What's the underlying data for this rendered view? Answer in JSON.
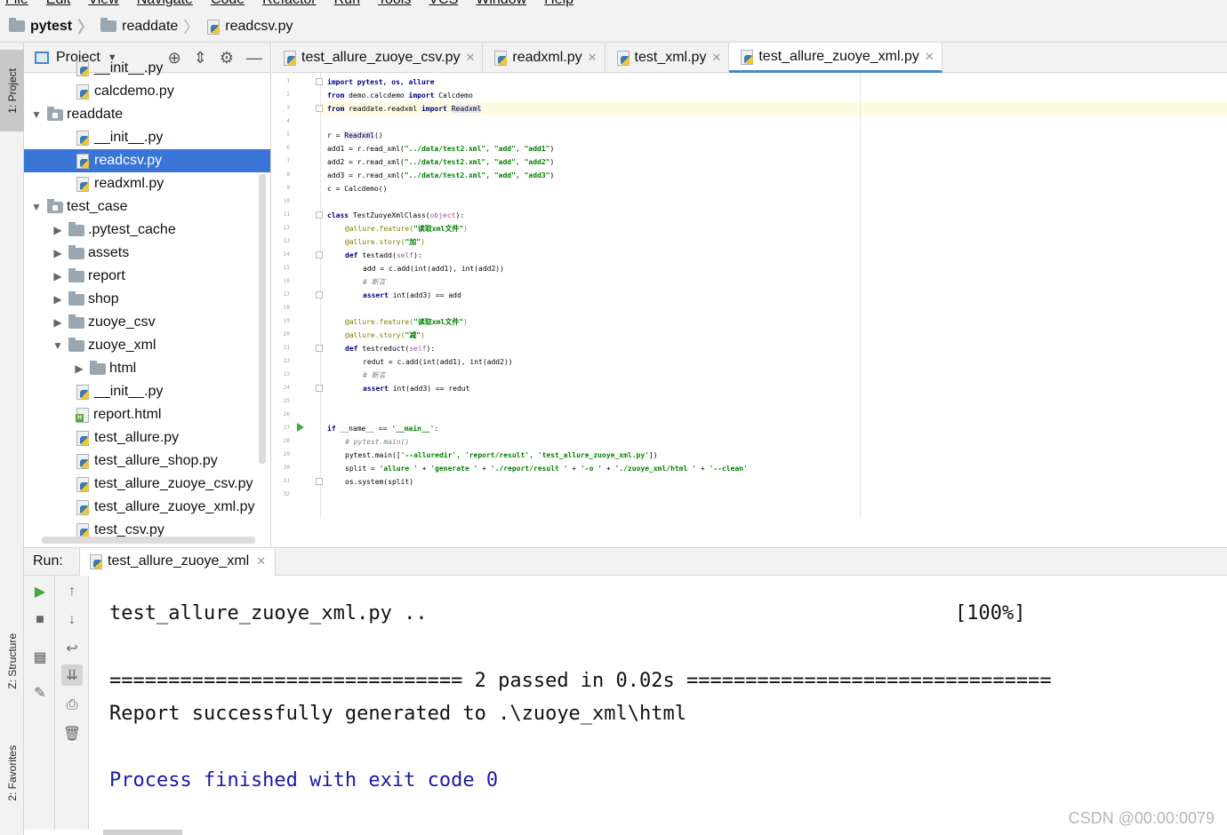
{
  "menubar": [
    "File",
    "Edit",
    "View",
    "Navigate",
    "Code",
    "Refactor",
    "Run",
    "Tools",
    "VCS",
    "Window",
    "Help"
  ],
  "breadcrumb": {
    "project": "pytest",
    "folder": "readdate",
    "file": "readcsv.py"
  },
  "left_strip": {
    "project_tab": "1: Project",
    "structure_tab": "Z: Structure",
    "favorites_tab": "2: Favorites"
  },
  "project_panel": {
    "title": "Project",
    "tree": [
      {
        "label": "__init__.py",
        "type": "py"
      },
      {
        "label": "calcdemo.py",
        "type": "py"
      },
      {
        "label": "readdate",
        "type": "dir",
        "expanded": true
      },
      {
        "label": "__init__.py",
        "type": "py"
      },
      {
        "label": "readcsv.py",
        "type": "py",
        "selected": true
      },
      {
        "label": "readxml.py",
        "type": "py"
      },
      {
        "label": "test_case",
        "type": "dir",
        "expanded": true
      },
      {
        "label": ".pytest_cache",
        "type": "dir"
      },
      {
        "label": "assets",
        "type": "dir"
      },
      {
        "label": "report",
        "type": "dir"
      },
      {
        "label": "shop",
        "type": "dir"
      },
      {
        "label": "zuoye_csv",
        "type": "dir"
      },
      {
        "label": "zuoye_xml",
        "type": "dir",
        "expanded": true
      },
      {
        "label": "html",
        "type": "dir"
      },
      {
        "label": "__init__.py",
        "type": "py"
      },
      {
        "label": "report.html",
        "type": "html"
      },
      {
        "label": "test_allure.py",
        "type": "py"
      },
      {
        "label": "test_allure_shop.py",
        "type": "py"
      },
      {
        "label": "test_allure_zuoye_csv.py",
        "type": "py"
      },
      {
        "label": "test_allure_zuoye_xml.py",
        "type": "py"
      },
      {
        "label": "test_csv.py",
        "type": "py"
      }
    ]
  },
  "editor_tabs": [
    {
      "label": "test_allure_zuoye_csv.py",
      "active": false
    },
    {
      "label": "readxml.py",
      "active": false
    },
    {
      "label": "test_xml.py",
      "active": false
    },
    {
      "label": "test_allure_zuoye_xml.py",
      "active": true
    }
  ],
  "code": {
    "line_numbers": [
      "1",
      "2",
      "3",
      "4",
      "5",
      "6",
      "7",
      "8",
      "9",
      "10",
      "11",
      "12",
      "13",
      "14",
      "15",
      "16",
      "17",
      "18",
      "19",
      "20",
      "21",
      "22",
      "23",
      "24",
      "25",
      "26",
      "27",
      "28",
      "29",
      "30",
      "31",
      "32"
    ],
    "l1": "import pytest, os, allure",
    "l2a": "from",
    "l2b": " demo.calcdemo ",
    "l2c": "import",
    "l2d": " Calcdemo",
    "l3a": "from",
    "l3b": " readdate.readxml ",
    "l3c": "import",
    "l3d": "Readxml",
    "l5a": "r = ",
    "l5b": "Readxml",
    "l5c": "()",
    "l6a": "add1 = r.read_xml(",
    "l6b": "\"../data/test2.xml\", \"add\", \"add1\"",
    "l6c": ")",
    "l7a": "add2 = r.read_xml(",
    "l7b": "\"../data/test2.xml\", \"add\", \"add2\"",
    "l7c": ")",
    "l8a": "add3 = r.read_xml(",
    "l8b": "\"../data/test2.xml\", \"add\", \"add3\"",
    "l8c": ")",
    "l9": "c = Calcdemo()",
    "l11a": "class",
    "l11b": " TestZuoyeXmlClass(",
    "l11c": "object",
    "l11d": "):",
    "l12a": "@allure.feature(",
    "l12b": "\"读取xml文件\"",
    "l12c": ")",
    "l13a": "@allure.story(",
    "l13b": "\"加\"",
    "l13c": ")",
    "l14a": "def",
    "l14b": " testadd(",
    "l14c": "self",
    "l14d": "):",
    "l15": "add = c.add(int(add1), int(add2))",
    "l16": "# 断言",
    "l17a": "assert",
    "l17b": " int(add3) == add",
    "l19a": "@allure.feature(",
    "l19b": "\"读取xml文件\"",
    "l19c": ")",
    "l20a": "@allure.story(",
    "l20b": "\"减\"",
    "l20c": ")",
    "l21a": "def",
    "l21b": " testreduct(",
    "l21c": "self",
    "l21d": "):",
    "l22": "redut = c.add(int(add1), int(add2))",
    "l23": "# 断言",
    "l24a": "assert",
    "l24b": " int(add3) == redut",
    "l27a": "if",
    "l27b": " __name__ == ",
    "l27c": "'__main__'",
    "l27d": ":",
    "l28": "# pytest.main()",
    "l29a": "pytest.main([",
    "l29b": "'--alluredir', 'report/result', 'test_allure_zuoye_xml.py'",
    "l29c": "])",
    "l30a": "split = ",
    "l30b": "'allure '",
    "l30c": " + ",
    "l30d": "'generate '",
    "l30e": " + ",
    "l30f": "'./report/result '",
    "l30g": " + ",
    "l30h": "'-o '",
    "l30i": " + ",
    "l30j": "'./zuoye_xml/html '",
    "l30k": " + ",
    "l30l": "'--clean'",
    "l31": "os.system(split)"
  },
  "run": {
    "label": "Run:",
    "tab": "test_allure_zuoye_xml",
    "console": {
      "line1": "test_allure_zuoye_xml.py ..",
      "line1_right": "[100%]",
      "line2": "============================== 2 passed in 0.02s ===============================",
      "line3": "Report successfully generated to .\\zuoye_xml\\html",
      "line4": "Process finished with exit code 0"
    }
  },
  "watermark": "CSDN @00:00:0079",
  "colors": {
    "selection": "#3875d7",
    "keyword": "#000080",
    "string": "#008000",
    "decorator": "#808000",
    "console_blue": "#1a1aa6"
  }
}
